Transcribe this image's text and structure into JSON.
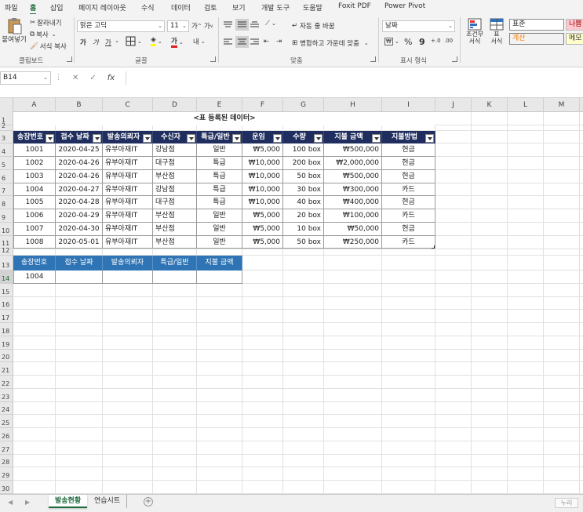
{
  "ribbon_tabs": [
    "파일",
    "홈",
    "삽입",
    "페이지 레이아웃",
    "수식",
    "데이터",
    "검토",
    "보기",
    "개발 도구",
    "도움말",
    "Foxit PDF",
    "Power Pivot"
  ],
  "clipboard": {
    "paste": "붙여넣기",
    "cut": "잘라내기",
    "copy": "복사",
    "format_painter": "서식 복사",
    "group": "클립보드"
  },
  "font": {
    "name": "맑은 고딕",
    "size": "11",
    "group": "글꼴",
    "grow": "가",
    "shrink": "가",
    "bold": "가",
    "italic": "가",
    "underline": "가",
    "font_color_glyph": "가",
    "phonetic": "내"
  },
  "alignment": {
    "wrap": "자동 줄 바꿈",
    "merge": "병합하고 가운데 맞춤",
    "group": "맞춤"
  },
  "number": {
    "format": "날짜",
    "percent": "%",
    "comma": "9",
    "group": "표시 형식"
  },
  "styles": {
    "conditional": "조건부\n서식",
    "table": "표\n서식",
    "normal": "표준",
    "bad": "나쁨",
    "calc": "계산",
    "memo": "메모"
  },
  "formula_bar": {
    "name_box": "B14",
    "formula": ""
  },
  "columns": [
    "A",
    "B",
    "C",
    "D",
    "E",
    "F",
    "G",
    "H",
    "I",
    "J",
    "K",
    "L",
    "M"
  ],
  "rows": [
    "1",
    "2",
    "3",
    "4",
    "5",
    "6",
    "7",
    "8",
    "9",
    "10",
    "11",
    "12",
    "13",
    "14",
    "15",
    "16",
    "17",
    "18",
    "19",
    "20",
    "21",
    "22",
    "23",
    "24",
    "25",
    "26",
    "27",
    "28",
    "29",
    "30"
  ],
  "sheet": {
    "title": "<표 등록된 데이터>",
    "table_headers": [
      "송장번호",
      "접수 날짜",
      "발송의뢰자",
      "수신자",
      "특급/일반",
      "운임",
      "수량",
      "지불 금액",
      "지불방법"
    ],
    "table_rows": [
      [
        "1001",
        "2020-04-25",
        "유부아재IT",
        "강남점",
        "일반",
        "₩5,000",
        "100 box",
        "₩500,000",
        "현금"
      ],
      [
        "1002",
        "2020-04-26",
        "유부아재IT",
        "대구점",
        "특급",
        "₩10,000",
        "200 box",
        "₩2,000,000",
        "현금"
      ],
      [
        "1003",
        "2020-04-26",
        "유부아재IT",
        "부산점",
        "특급",
        "₩10,000",
        "50 box",
        "₩500,000",
        "현금"
      ],
      [
        "1004",
        "2020-04-27",
        "유부아재IT",
        "강남점",
        "특급",
        "₩10,000",
        "30 box",
        "₩300,000",
        "카드"
      ],
      [
        "1005",
        "2020-04-28",
        "유부아재IT",
        "대구점",
        "특급",
        "₩10,000",
        "40 box",
        "₩400,000",
        "현금"
      ],
      [
        "1006",
        "2020-04-29",
        "유부아재IT",
        "부산점",
        "일반",
        "₩5,000",
        "20 box",
        "₩100,000",
        "카드"
      ],
      [
        "1007",
        "2020-04-30",
        "유부아재IT",
        "부산점",
        "일반",
        "₩5,000",
        "10 box",
        "₩50,000",
        "현금"
      ],
      [
        "1008",
        "2020-05-01",
        "유부아재IT",
        "부산점",
        "일반",
        "₩5,000",
        "50 box",
        "₩250,000",
        "카드"
      ]
    ],
    "lookup_headers": [
      "송장번호",
      "접수 날짜",
      "발송의뢰자",
      "특급/일반",
      "지불 금액"
    ],
    "lookup_values": [
      "1004",
      "",
      "",
      "",
      ""
    ]
  },
  "sheet_tabs": [
    "발송현황",
    "연습시트"
  ],
  "status_button": "누리"
}
